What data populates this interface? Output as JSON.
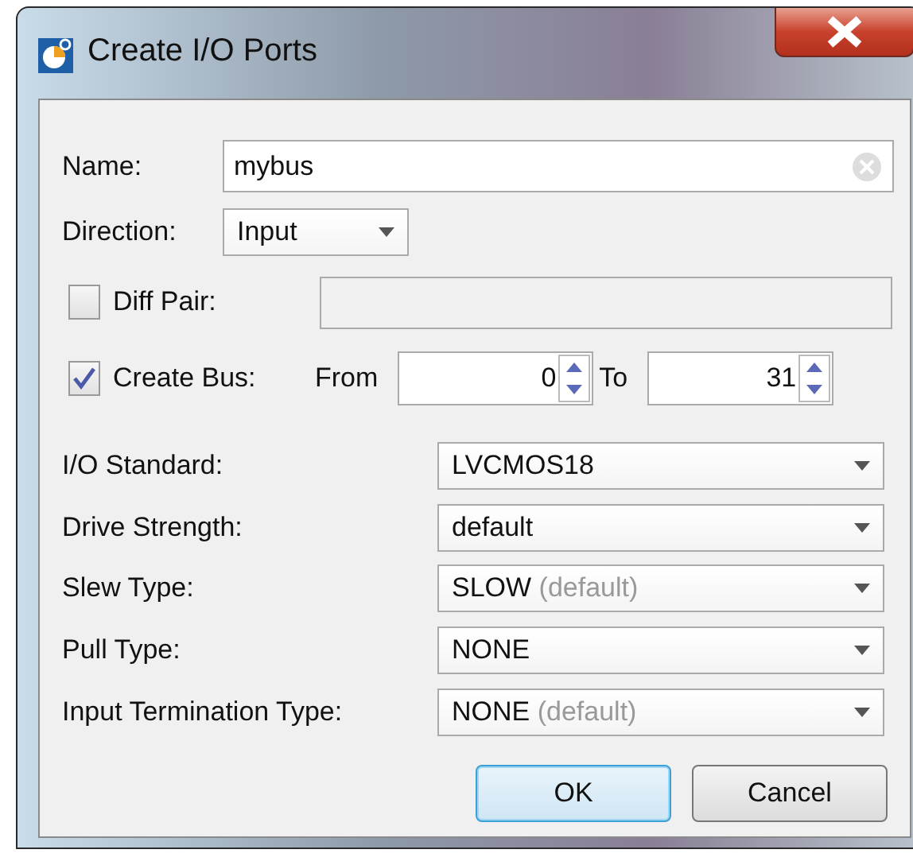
{
  "window": {
    "title": "Create I/O Ports"
  },
  "name": {
    "label": "Name:",
    "value": "mybus"
  },
  "direction": {
    "label": "Direction:",
    "value": "Input"
  },
  "diff_pair": {
    "label": "Diff Pair:",
    "checked": false,
    "disabled": true
  },
  "create_bus": {
    "label": "Create Bus:",
    "checked": true,
    "from_label": "From",
    "from": "0",
    "to_label": "To",
    "to": "31"
  },
  "properties": [
    {
      "label": "I/O Standard:",
      "value": "LVCMOS18"
    },
    {
      "label": "Drive Strength:",
      "value": "default"
    },
    {
      "label": "Slew Type:",
      "value": "SLOW",
      "hint": "(default)"
    },
    {
      "label": "Pull Type:",
      "value": "NONE"
    },
    {
      "label": "Input Termination Type:",
      "value": "NONE",
      "hint": "(default)"
    }
  ],
  "buttons": [
    {
      "label": "OK",
      "selected": true
    },
    {
      "label": "Cancel",
      "selected": false
    }
  ]
}
